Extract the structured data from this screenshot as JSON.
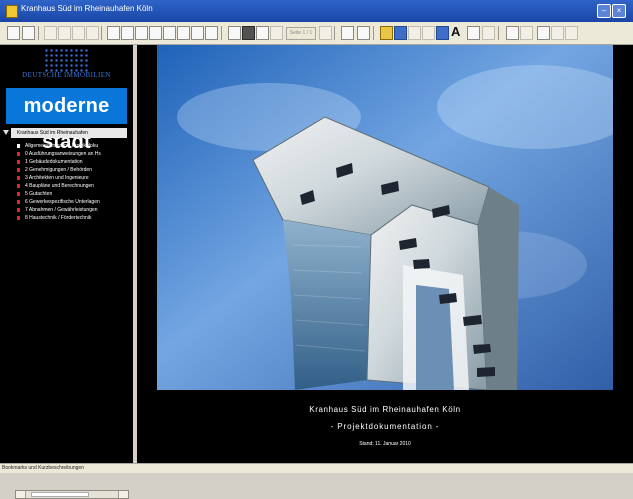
{
  "window": {
    "title": "Kranhaus Süd im Rheinauhafen Köln"
  },
  "toolbar": {
    "page_label": "Seite 1 / 1",
    "text_tool_label": "A"
  },
  "sidebar": {
    "logo_top": "DEUTSCHE IMMOBILIEN",
    "logo_main": "moderne stadt",
    "tree_title": "Kranhaus Süd im Rheinauhafen",
    "items": [
      "Allgemeine Infos zur Projektdoku",
      "0 Ausführungsanweisungen an Hs",
      "1 Gebäudedokumentation",
      "2 Genehmigungen / Behörden",
      "3 Architekten und Ingenieure",
      "4 Baupläne und Berechnungen",
      "5 Gutachten",
      "6 Gewerkespezifische Unterlagen",
      "7 Abnahmen / Gewährleistungen",
      "8 Haustechnik / Fördertechnik"
    ]
  },
  "main": {
    "caption_title": "Kranhaus Süd im Rheinauhafen Köln",
    "caption_subtitle": "- Projektdokumentation -",
    "caption_date": "Stand:  11. Januar 2010"
  },
  "status": {
    "text": "Bookmarks und Kurzbeschreibungen"
  },
  "colors": {
    "accent": "#0877d9",
    "bullet": "#d92b21",
    "background": "#000000"
  }
}
